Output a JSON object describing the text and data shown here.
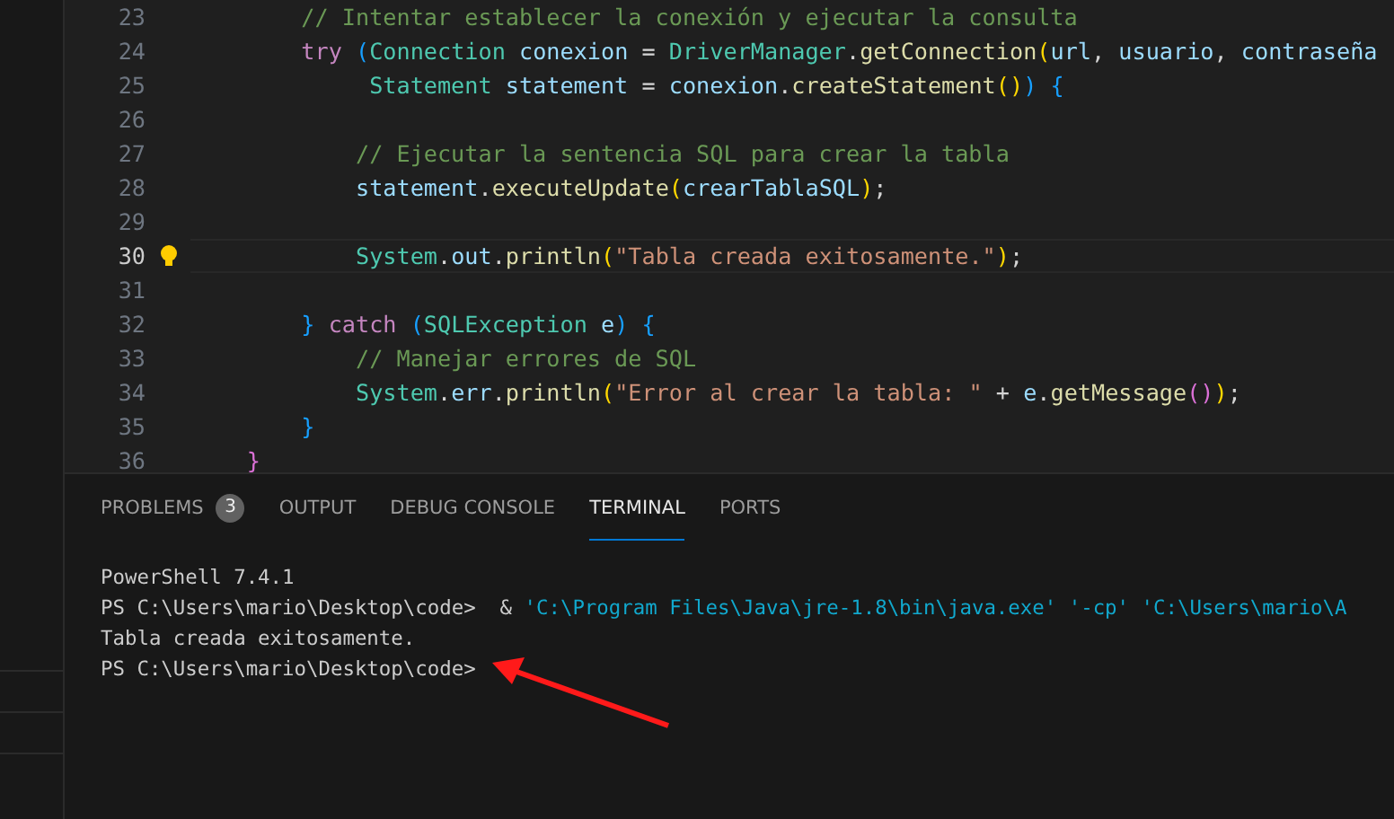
{
  "editor": {
    "lines": [
      {
        "number": "23",
        "current": false,
        "lightbulb": false,
        "tokens": [
          {
            "text": "        // Intentar establecer la conexión y ejecutar la consulta",
            "kind": "comment"
          }
        ]
      },
      {
        "number": "24",
        "current": false,
        "lightbulb": false,
        "tokens": [
          {
            "text": "        try",
            "kind": "keyword"
          },
          {
            "text": " (",
            "kind": "bracket3"
          },
          {
            "text": "Connection",
            "kind": "type"
          },
          {
            "text": " conexion",
            "kind": "variable"
          },
          {
            "text": " = ",
            "kind": "plain"
          },
          {
            "text": "DriverManager",
            "kind": "type"
          },
          {
            "text": ".",
            "kind": "plain"
          },
          {
            "text": "getConnection",
            "kind": "method"
          },
          {
            "text": "(",
            "kind": "bracket1"
          },
          {
            "text": "url",
            "kind": "variable"
          },
          {
            "text": ", ",
            "kind": "plain"
          },
          {
            "text": "usuario",
            "kind": "variable"
          },
          {
            "text": ", ",
            "kind": "plain"
          },
          {
            "text": "contraseña",
            "kind": "variable"
          }
        ]
      },
      {
        "number": "25",
        "current": false,
        "lightbulb": false,
        "tokens": [
          {
            "text": "             Statement",
            "kind": "type"
          },
          {
            "text": " statement",
            "kind": "variable"
          },
          {
            "text": " = ",
            "kind": "plain"
          },
          {
            "text": "conexion",
            "kind": "variable"
          },
          {
            "text": ".",
            "kind": "plain"
          },
          {
            "text": "createStatement",
            "kind": "method"
          },
          {
            "text": "()",
            "kind": "bracket1"
          },
          {
            "text": ")",
            "kind": "bracket3"
          },
          {
            "text": " {",
            "kind": "bracket3"
          }
        ]
      },
      {
        "number": "26",
        "current": false,
        "lightbulb": false
      },
      {
        "number": "27",
        "current": false,
        "lightbulb": false,
        "tokens": [
          {
            "text": "            // Ejecutar la sentencia SQL para crear la tabla",
            "kind": "comment"
          }
        ]
      },
      {
        "number": "28",
        "current": false,
        "lightbulb": false,
        "tokens": [
          {
            "text": "            statement",
            "kind": "variable"
          },
          {
            "text": ".",
            "kind": "plain"
          },
          {
            "text": "executeUpdate",
            "kind": "method"
          },
          {
            "text": "(",
            "kind": "bracket1"
          },
          {
            "text": "crearTablaSQL",
            "kind": "variable"
          },
          {
            "text": ")",
            "kind": "bracket1"
          },
          {
            "text": ";",
            "kind": "plain"
          }
        ]
      },
      {
        "number": "29",
        "current": false,
        "lightbulb": false
      },
      {
        "number": "30",
        "current": true,
        "lightbulb": true,
        "tokens": [
          {
            "text": "            System",
            "kind": "type"
          },
          {
            "text": ".",
            "kind": "plain"
          },
          {
            "text": "out",
            "kind": "variable"
          },
          {
            "text": ".",
            "kind": "plain"
          },
          {
            "text": "println",
            "kind": "method"
          },
          {
            "text": "(",
            "kind": "bracket1"
          },
          {
            "text": "\"Tabla creada exitosamente.\"",
            "kind": "string"
          },
          {
            "text": ")",
            "kind": "bracket1"
          },
          {
            "text": ";",
            "kind": "plain"
          }
        ]
      },
      {
        "number": "31",
        "current": false,
        "lightbulb": false
      },
      {
        "number": "32",
        "current": false,
        "lightbulb": false,
        "tokens": [
          {
            "text": "        }",
            "kind": "bracket3"
          },
          {
            "text": " catch",
            "kind": "keyword"
          },
          {
            "text": " (",
            "kind": "bracket3"
          },
          {
            "text": "SQLException",
            "kind": "type"
          },
          {
            "text": " e",
            "kind": "variable"
          },
          {
            "text": ")",
            "kind": "bracket3"
          },
          {
            "text": " {",
            "kind": "bracket3"
          }
        ]
      },
      {
        "number": "33",
        "current": false,
        "lightbulb": false,
        "tokens": [
          {
            "text": "            // Manejar errores de SQL",
            "kind": "comment"
          }
        ]
      },
      {
        "number": "34",
        "current": false,
        "lightbulb": false,
        "tokens": [
          {
            "text": "            System",
            "kind": "type"
          },
          {
            "text": ".",
            "kind": "plain"
          },
          {
            "text": "err",
            "kind": "variable"
          },
          {
            "text": ".",
            "kind": "plain"
          },
          {
            "text": "println",
            "kind": "method"
          },
          {
            "text": "(",
            "kind": "bracket1"
          },
          {
            "text": "\"Error al crear la tabla: \"",
            "kind": "string"
          },
          {
            "text": " + ",
            "kind": "plain"
          },
          {
            "text": "e",
            "kind": "variable"
          },
          {
            "text": ".",
            "kind": "plain"
          },
          {
            "text": "getMessage",
            "kind": "method"
          },
          {
            "text": "()",
            "kind": "bracket2"
          },
          {
            "text": ")",
            "kind": "bracket1"
          },
          {
            "text": ";",
            "kind": "plain"
          }
        ]
      },
      {
        "number": "35",
        "current": false,
        "lightbulb": false,
        "tokens": [
          {
            "text": "        }",
            "kind": "bracket3"
          }
        ]
      },
      {
        "number": "36",
        "current": false,
        "lightbulb": false,
        "tokens": [
          {
            "text": "    }",
            "kind": "bracket2"
          }
        ]
      }
    ]
  },
  "panel": {
    "tabs": [
      {
        "label": "PROBLEMS",
        "selected": false,
        "badge": "3"
      },
      {
        "label": "OUTPUT",
        "selected": false
      },
      {
        "label": "DEBUG CONSOLE",
        "selected": false
      },
      {
        "label": "TERMINAL",
        "selected": true
      },
      {
        "label": "PORTS",
        "selected": false
      }
    ],
    "terminal": [
      {
        "tokens": [
          {
            "text": "PowerShell 7.4.1",
            "kind": "plain"
          }
        ]
      },
      {
        "tokens": [
          {
            "text": "PS C:\\Users\\mario\\Desktop\\code>  & ",
            "kind": "plain"
          },
          {
            "text": "'C:\\Program Files\\Java\\jre-1.8\\bin\\java.exe' '-cp' 'C:\\Users\\mario\\A",
            "kind": "path"
          }
        ]
      },
      {
        "tokens": [
          {
            "text": "Tabla creada exitosamente.",
            "kind": "plain"
          }
        ]
      },
      {
        "tokens": [
          {
            "text": "PS C:\\Users\\mario\\Desktop\\code>",
            "kind": "plain"
          }
        ]
      }
    ]
  }
}
